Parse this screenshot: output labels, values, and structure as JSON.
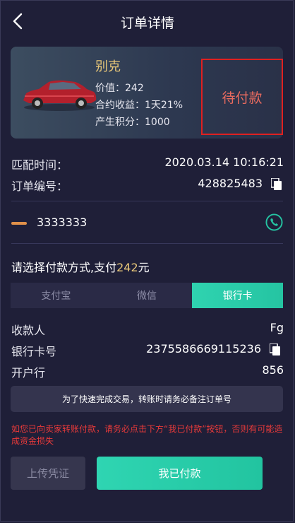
{
  "header": {
    "title": "订单详情"
  },
  "product": {
    "name": "别克",
    "value_line": "价值：242",
    "yield_line": "合约收益：1天21%",
    "points_line": "产生积分：1000",
    "status": "待付款",
    "status_color": "#e96b5f",
    "highlight_border_color": "#e02020"
  },
  "order": {
    "match_time_label": "匹配时间：",
    "match_time": "2020.03.14 10:16:21",
    "order_no_label": "订单编号：",
    "order_no": "428825483"
  },
  "contact": {
    "phone": "3333333"
  },
  "payment": {
    "prompt_prefix": "请选择付款方式,支付",
    "amount": "242",
    "prompt_suffix": "元",
    "tabs": [
      "支付宝",
      "微信",
      "银行卡"
    ],
    "active_tab": "银行卡"
  },
  "bank": {
    "payee_label": "收款人",
    "payee": "Fg",
    "card_label": "银行卡号",
    "card_no": "2375586669115236",
    "bank_label": "开户行",
    "bank_name": "856"
  },
  "notice": "为了快速完成交易，转账时请务必备注订单号",
  "warning": "如您已向卖家转账付款，请务必点击下方“我已付款”按钮，否则有可能造成资金损失",
  "buttons": {
    "upload": "上传凭证",
    "paid": "我已付款"
  },
  "colors": {
    "accent": "#25c4a2",
    "gold": "#e8c779",
    "warning": "#e83a3a",
    "background": "#1f1f38"
  }
}
